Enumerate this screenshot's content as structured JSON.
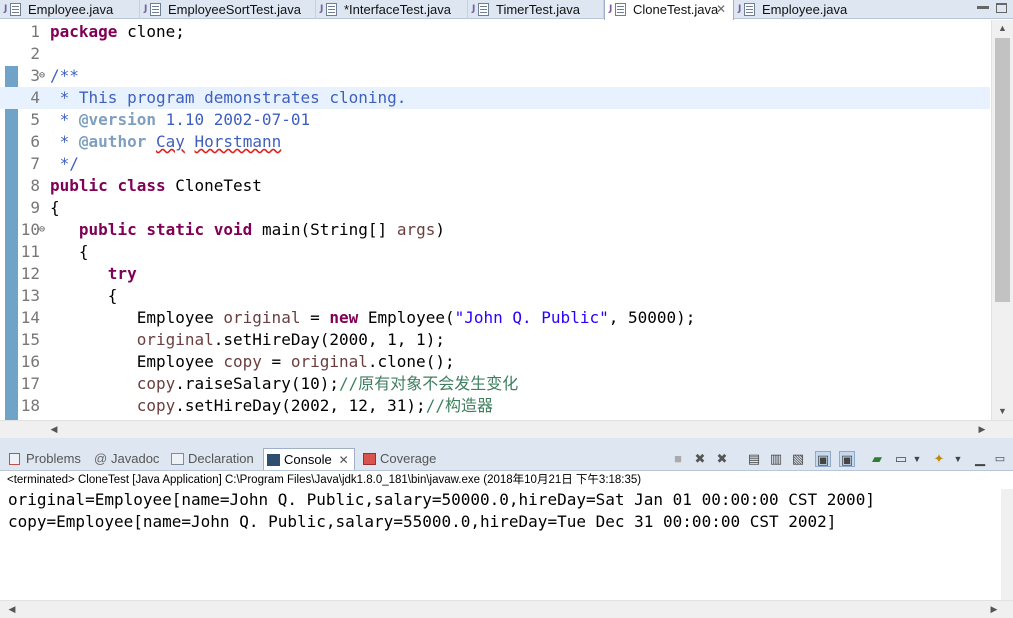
{
  "tabs": [
    {
      "label": "Employee.java"
    },
    {
      "label": "EmployeeSortTest.java"
    },
    {
      "label": "*InterfaceTest.java"
    },
    {
      "label": "TimerTest.java"
    },
    {
      "label": "CloneTest.java",
      "active": true
    },
    {
      "label": "Employee.java"
    }
  ],
  "editor": {
    "lines": [
      {
        "n": "1",
        "text": "package clone;"
      },
      {
        "n": "2",
        "text": ""
      },
      {
        "n": "3",
        "text": "/**",
        "fold": true
      },
      {
        "n": "4",
        "text": " * This program demonstrates cloning."
      },
      {
        "n": "5",
        "text": " * @version 1.10 2002-07-01"
      },
      {
        "n": "6",
        "text": " * @author Cay Horstmann"
      },
      {
        "n": "7",
        "text": " */"
      },
      {
        "n": "8",
        "text": "public class CloneTest"
      },
      {
        "n": "9",
        "text": "{"
      },
      {
        "n": "10",
        "text": "   public static void main(String[] args)",
        "fold": true
      },
      {
        "n": "11",
        "text": "   {"
      },
      {
        "n": "12",
        "text": "      try"
      },
      {
        "n": "13",
        "text": "      {"
      },
      {
        "n": "14",
        "text": "         Employee original = new Employee(\"John Q. Public\", 50000);"
      },
      {
        "n": "15",
        "text": "         original.setHireDay(2000, 1, 1);"
      },
      {
        "n": "16",
        "text": "         Employee copy = original.clone();"
      },
      {
        "n": "17",
        "text": "         copy.raiseSalary(10);//原有对象不会发生变化"
      },
      {
        "n": "18",
        "text": "         copy.setHireDay(2002, 12, 31);//构造器"
      }
    ]
  },
  "panel": {
    "tabs": [
      {
        "label": "Problems"
      },
      {
        "label": "Javadoc"
      },
      {
        "label": "Declaration"
      },
      {
        "label": "Console",
        "active": true
      },
      {
        "label": "Coverage"
      }
    ],
    "status": "<terminated> CloneTest [Java Application] C:\\Program Files\\Java\\jdk1.8.0_181\\bin\\javaw.exe (2018年10月21日 下午3:18:35)",
    "output": [
      "original=Employee[name=John Q. Public,salary=50000.0,hireDay=Sat Jan 01 00:00:00 CST 2000]",
      "copy=Employee[name=John Q. Public,salary=55000.0,hireDay=Tue Dec 31 00:00:00 CST 2002]"
    ]
  },
  "icons": {
    "close_tab": "✕",
    "fold": "⊖"
  },
  "colors": {
    "keyword": "#7f0055",
    "javadoc": "#3f5fbf",
    "string": "#2a00ff",
    "comment": "#3f7f5f",
    "variable": "#6a3e3e",
    "tabbar": "#dde6f1"
  }
}
